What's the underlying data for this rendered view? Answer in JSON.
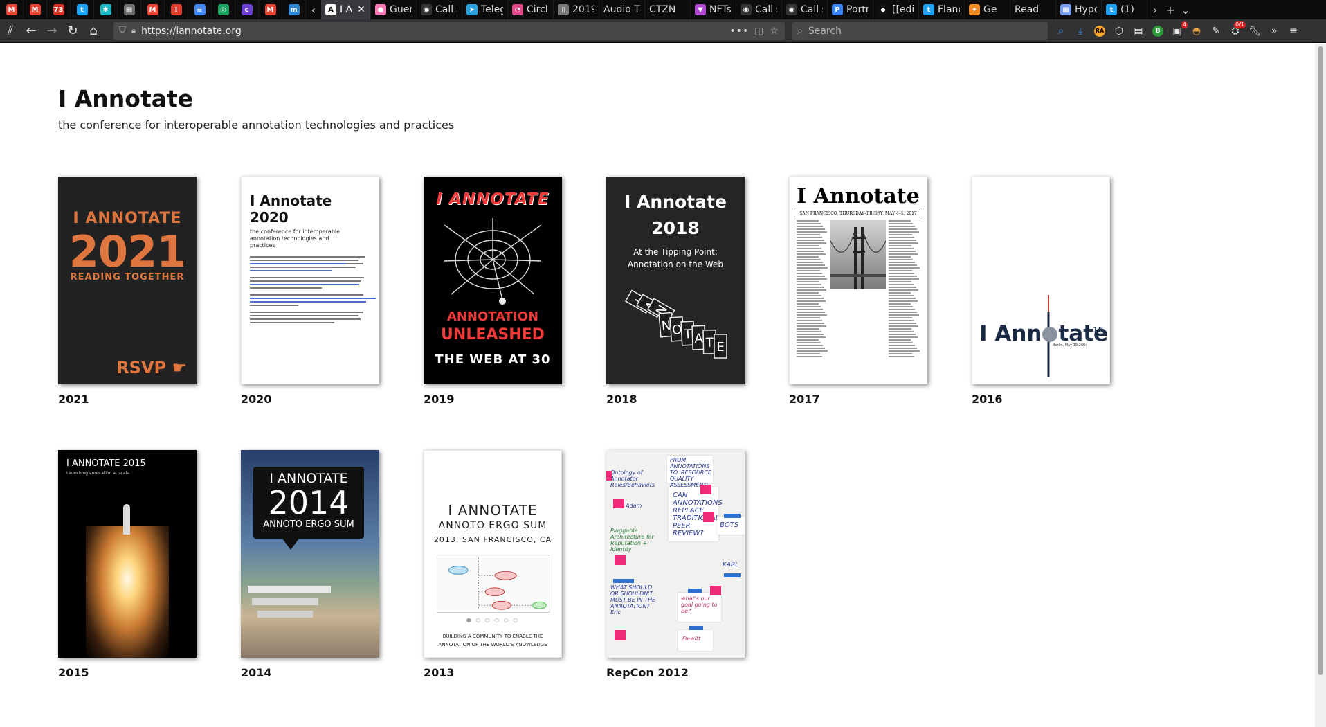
{
  "browser": {
    "tabs": [
      {
        "type": "pinned",
        "icon": "gmail-icon",
        "color": "#ea4335",
        "glyph": "M"
      },
      {
        "type": "pinned",
        "icon": "gmail-calendar-icon",
        "color": "#ea4335",
        "glyph": "M"
      },
      {
        "type": "pinned",
        "icon": "notification-73-icon",
        "color": "#d93025",
        "glyph": "73"
      },
      {
        "type": "pinned",
        "icon": "twitter-icon",
        "color": "#1da1f2",
        "glyph": "t"
      },
      {
        "type": "pinned",
        "icon": "puzzle-icon",
        "color": "#1db9c3",
        "glyph": "✱"
      },
      {
        "type": "pinned",
        "icon": "reader-icon",
        "color": "#6e6e6e",
        "glyph": "▤"
      },
      {
        "type": "pinned",
        "icon": "gmail-icon",
        "color": "#ea4335",
        "glyph": "M"
      },
      {
        "type": "pinned",
        "icon": "alert-icon",
        "color": "#e03d2e",
        "glyph": "!"
      },
      {
        "type": "pinned",
        "icon": "docs-icon",
        "color": "#4285f4",
        "glyph": "≡"
      },
      {
        "type": "pinned",
        "icon": "chat-icon",
        "color": "#1aa260",
        "glyph": "◎"
      },
      {
        "type": "pinned",
        "icon": "c-icon",
        "color": "#6c3fd6",
        "glyph": "c"
      },
      {
        "type": "pinned",
        "icon": "gmail-icon",
        "color": "#ea4335",
        "glyph": "M"
      },
      {
        "type": "pinned",
        "icon": "mastodon-icon",
        "color": "#3088d4",
        "glyph": "m"
      }
    ],
    "scroll_left_icon": "chevron-left-icon",
    "open_tabs": [
      {
        "label": "I A",
        "icon": "annotate-icon",
        "color": "#ffffff",
        "glyph": "A",
        "active": true
      },
      {
        "label": "Guer",
        "icon": "pig-icon",
        "color": "#ff7ab4",
        "glyph": "●"
      },
      {
        "label": "Call s",
        "icon": "github-icon",
        "color": "#333333",
        "glyph": "◉"
      },
      {
        "label": "Teleg",
        "icon": "telegram-icon",
        "color": "#2aa1da",
        "glyph": "➤"
      },
      {
        "label": "Circl",
        "icon": "circle-icon",
        "color": "#e04a8a",
        "glyph": "◔"
      },
      {
        "label": "2019",
        "icon": "document-icon",
        "color": "#777777",
        "glyph": "▯"
      },
      {
        "label": "Audio Ti",
        "icon": "",
        "color": "",
        "glyph": ""
      },
      {
        "label": "CTZN",
        "icon": "",
        "color": "",
        "glyph": ""
      },
      {
        "label": "NFTs",
        "icon": "nft-icon",
        "color": "#b04ad6",
        "glyph": "▼"
      },
      {
        "label": "Call s",
        "icon": "github-icon",
        "color": "#333333",
        "glyph": "◉"
      },
      {
        "label": "Call s",
        "icon": "github-icon",
        "color": "#333333",
        "glyph": "◉"
      },
      {
        "label": "Portr",
        "icon": "portrait-icon",
        "color": "#3b82f6",
        "glyph": "P"
      },
      {
        "label": "[[edi",
        "icon": "wiki-icon",
        "color": "#111111",
        "glyph": "◆"
      },
      {
        "label": "Flanc",
        "icon": "twitter-icon",
        "color": "#1da1f2",
        "glyph": "t"
      },
      {
        "label": "Ge",
        "icon": "rocket-icon",
        "color": "#f08a24",
        "glyph": "✦"
      },
      {
        "label": "Read",
        "icon": "",
        "color": "",
        "glyph": ""
      },
      {
        "label": "Hypo",
        "icon": "grid-icon",
        "color": "#7a9cf0",
        "glyph": "▦"
      },
      {
        "label": "(1)",
        "icon": "twitter-icon",
        "color": "#1da1f2",
        "glyph": "t"
      }
    ],
    "scroll_right_icon": "chevron-right-icon",
    "new_tab_icon": "plus-icon",
    "tab_menu_icon": "chevron-down-icon",
    "url": "https://iannotate.org",
    "search_placeholder": "Search",
    "notification_count": "4",
    "extension_badge": "0/1"
  },
  "site": {
    "title": "I Annotate",
    "subtitle": "the conference for interoperable annotation technologies and practices"
  },
  "editions": [
    {
      "year": "2021",
      "cover": {
        "line1": "I ANNOTATE",
        "line2": "2021",
        "line3": "READING TOGETHER",
        "line4": "RSVP ☛"
      }
    },
    {
      "year": "2020",
      "cover": {
        "line1": "I Annotate 2020",
        "line2": "the conference for interoperable annotation technologies and practices"
      }
    },
    {
      "year": "2019",
      "cover": {
        "line1": "I ANNOTATE",
        "line2": "ANNOTATION",
        "line3": "UNLEASHED",
        "line4": "THE WEB AT 30"
      }
    },
    {
      "year": "2018",
      "cover": {
        "line1": "I Annotate",
        "line2": "2018",
        "line3": "At the Tipping Point:",
        "line4": "Annotation on the Web",
        "blocks": [
          "I",
          "A",
          "N",
          "N",
          "O",
          "T",
          "A",
          "T",
          "E"
        ]
      }
    },
    {
      "year": "2017",
      "cover": {
        "line1": "I Annotate",
        "line2": "SAN FRANCISCO, THURSDAY–FRIDAY, MAY 4–5, 2017"
      }
    },
    {
      "year": "2016",
      "cover": {
        "line1": "I Ann",
        "line1b": "tate",
        "sup": "16",
        "line2": "Berlin, May 19-20th"
      }
    },
    {
      "year": "2015",
      "cover": {
        "line1": "I ANNOTATE 2015",
        "line2": "Launching annotation at scale."
      }
    },
    {
      "year": "2014",
      "cover": {
        "line1": "I ANNOTATE",
        "line2": "2014",
        "line3": "ANNOTO ERGO SUM"
      }
    },
    {
      "year": "2013",
      "cover": {
        "line1": "I ANNOTATE",
        "line2": "ANNOTO ERGO SUM",
        "line3": "2013, SAN FRANCISCO, CA",
        "line4": "BUILDING A COMMUNITY TO ENABLE THE",
        "line5": "ANNOTATION OF THE WORLD'S KNOWLEDGE"
      }
    },
    {
      "year": "RepCon 2012",
      "cover": {
        "note1": "FROM ANNOTATIONS TO 'RESOURCE QUALITY ASSESSMENT'",
        "note2": "CAN ANNOTATIONS REPLACE TRADITIONAL PEER REVIEW?",
        "note3": "BOTS",
        "note4": "KARL",
        "note5": "what's our goal going to be?",
        "note6": "Dewitt",
        "note7": "Adam",
        "note8": "Ontology of Annotator Roles/Behaviors",
        "note9": "Pluggable Architecture for Reputation + Identity",
        "note10": "WHAT SHOULD OR SHOULDN'T MUST BE IN THE ANNOTATION? Eric"
      }
    }
  ]
}
